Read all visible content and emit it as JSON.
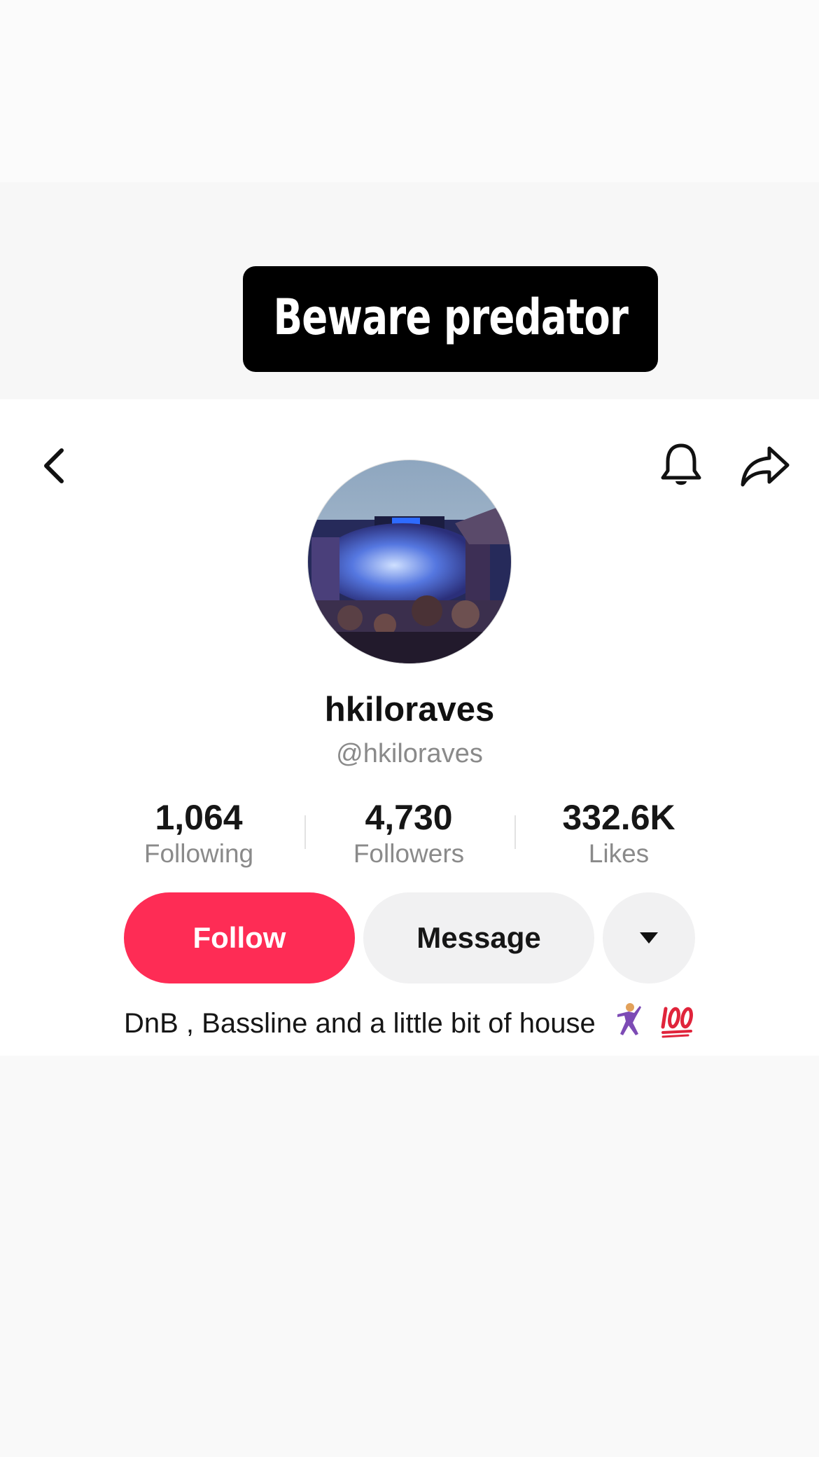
{
  "story_overlay": {
    "label": "Beware predator"
  },
  "header": {
    "back_icon": "chevron-left-icon",
    "notification_icon": "bell-icon",
    "share_icon": "share-arrow-icon"
  },
  "profile": {
    "display_name": "hkiloraves",
    "handle": "@hkiloraves",
    "avatar": "concert-crowd-photo"
  },
  "stats": [
    {
      "value": "1,064",
      "label": "Following"
    },
    {
      "value": "4,730",
      "label": "Followers"
    },
    {
      "value": "332.6K",
      "label": "Likes"
    }
  ],
  "actions": {
    "follow_label": "Follow",
    "message_label": "Message",
    "more_icon": "caret-down-icon"
  },
  "bio": {
    "text": "DnB , Bassline and a little bit of house",
    "emojis": [
      "dancing-man-emoji",
      "hundred-points-emoji"
    ]
  },
  "colors": {
    "follow": "#fe2c55",
    "secondary_button": "#f1f1f2",
    "muted_text": "#8a8a8a"
  }
}
